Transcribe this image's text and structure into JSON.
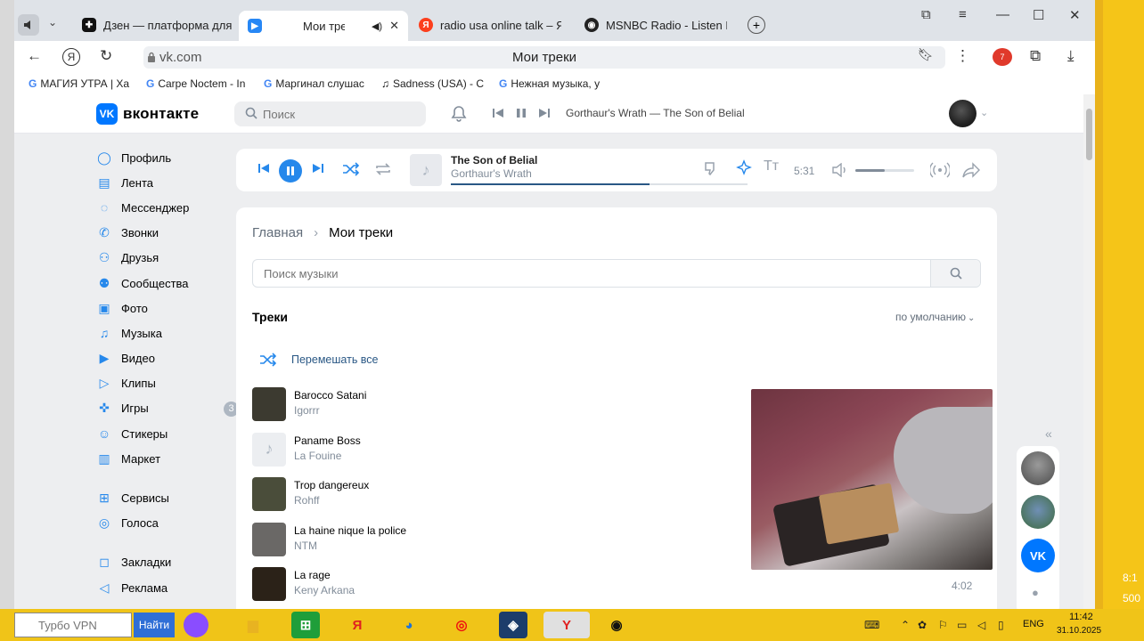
{
  "browser": {
    "tabs": [
      {
        "label": "Дзен — платформа для п",
        "favicon_color": "#111111",
        "favicon_glyph": "✚"
      },
      {
        "label": "Мои треки",
        "favicon_color": "#2787f5",
        "favicon_glyph": "▶"
      },
      {
        "label": "radio usa online talk – Янд",
        "favicon_color": "#fc3f1d",
        "favicon_glyph": "Я"
      },
      {
        "label": "MSNBC Radio - Listen Live",
        "favicon_color": "#222222",
        "favicon_glyph": "◉"
      }
    ],
    "url": "vk.com",
    "page_title": "Мои треки",
    "bookmarks": [
      {
        "label": "МАГИЯ УТРА | Ха",
        "icon": "google-icon"
      },
      {
        "label": "Carpe Noctem - In",
        "icon": "google-icon"
      },
      {
        "label": "Маргинал слушас",
        "icon": "google-icon"
      },
      {
        "label": "Sadness (USA) - C",
        "icon": "music-note-icon"
      },
      {
        "label": "Нежная музыка, у",
        "icon": "google-icon"
      }
    ],
    "extension_badge": "7"
  },
  "vk": {
    "logo_text": "вконтакте",
    "logo_mark": "VK",
    "search_placeholder": "Поиск",
    "header_now_playing": "Gorthaur's Wrath — The Son of Belial",
    "nav": [
      {
        "label": "Профиль",
        "icon": "profile-icon"
      },
      {
        "label": "Лента",
        "icon": "feed-icon"
      },
      {
        "label": "Мессенджер",
        "icon": "messenger-icon"
      },
      {
        "label": "Звонки",
        "icon": "phone-icon"
      },
      {
        "label": "Друзья",
        "icon": "friends-icon"
      },
      {
        "label": "Сообщества",
        "icon": "communities-icon"
      },
      {
        "label": "Фото",
        "icon": "photo-icon"
      },
      {
        "label": "Музыка",
        "icon": "music-icon"
      },
      {
        "label": "Видео",
        "icon": "video-icon"
      },
      {
        "label": "Клипы",
        "icon": "clips-icon"
      },
      {
        "label": "Игры",
        "icon": "games-icon",
        "badge": "3"
      },
      {
        "label": "Стикеры",
        "icon": "stickers-icon"
      },
      {
        "label": "Маркет",
        "icon": "market-icon"
      }
    ],
    "nav2": [
      {
        "label": "Сервисы",
        "icon": "services-icon"
      },
      {
        "label": "Голоса",
        "icon": "votes-icon"
      }
    ],
    "nav3": [
      {
        "label": "Закладки",
        "icon": "bookmarks-icon"
      },
      {
        "label": "Реклама",
        "icon": "ads-icon"
      }
    ],
    "player": {
      "title": "The Son of Belial",
      "artist": "Gorthaur's Wrath",
      "time": "5:31",
      "progress": 0.67,
      "volume": 0.5
    },
    "breadcrumb": {
      "home": "Главная",
      "current": "Мои треки"
    },
    "music_search_placeholder": "Поиск музыки",
    "tracks_heading": "Треки",
    "sort_label": "по умолчанию",
    "shuffle_all_label": "Перемешать все",
    "tracks": [
      {
        "title": "Barocco Satani",
        "artist": "Igorrr",
        "cover_color": "#3c3a30"
      },
      {
        "title": "Paname Boss",
        "artist": "La Fouine",
        "cover_color": "#eceef1"
      },
      {
        "title": "Trop dangereux",
        "artist": "Rohff",
        "cover_color": "#4a4d3a"
      },
      {
        "title": "La haine nique la police",
        "artist": "NTM",
        "cover_color": "#6a6866"
      },
      {
        "title": "La rage",
        "artist": "Keny Arkana",
        "cover_color": "#2b2218"
      }
    ],
    "video_duration": "4:02"
  },
  "right_edge": {
    "line1": "8:1",
    "line2": "500"
  },
  "taskbar": {
    "search_placeholder": "Турбо VPN",
    "find_button": "Найти",
    "language": "ENG",
    "time": "11:42",
    "date": "31.10.2025"
  }
}
